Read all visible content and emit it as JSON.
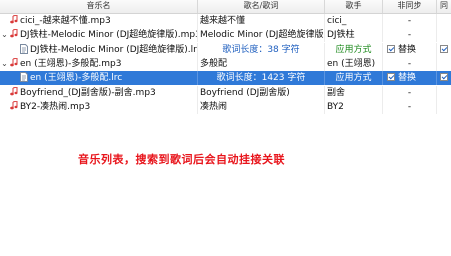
{
  "columns": [
    "音乐名",
    "歌名/歌词",
    "歌手",
    "非同步",
    "同"
  ],
  "rows": [
    {
      "type": "music",
      "expand": "",
      "name": "cici_-越来越不懂.mp3",
      "song": "越来越不懂",
      "singer": "cici_",
      "async": "-",
      "sync": ""
    },
    {
      "type": "music",
      "expand": "⌄",
      "name": "DJ铁柱-Melodic Minor (DJ超绝旋律版).mp3",
      "song": "Melodic Minor (DJ超绝旋律版)",
      "singer": "DJ铁柱",
      "async": "-",
      "sync": ""
    },
    {
      "type": "lrc",
      "name": "DJ铁柱-Melodic Minor (DJ超绝旋律版).lrc",
      "info": "歌词长度：38 字符",
      "mode": "应用方式",
      "async_label": "替换",
      "async_checked": true,
      "sync_checked": true
    },
    {
      "type": "music",
      "expand": "⌄",
      "name": "en (王翊恩)-多般配.mp3",
      "song": "多般配",
      "singer": "en (王翊恩)",
      "async": "-",
      "sync": ""
    },
    {
      "type": "lrc",
      "selected": true,
      "name": "en (王翊恩)-多般配.lrc",
      "info": "歌词长度：1423 字符",
      "mode": "应用方式",
      "async_label": "替换",
      "async_checked": true,
      "sync_checked": true
    },
    {
      "type": "music",
      "expand": "",
      "name": "Boyfriend_(DJ副舍版)-副舍.mp3",
      "song": "Boyfriend (DJ副舍版)",
      "singer": "副舍",
      "async": "-",
      "sync": ""
    },
    {
      "type": "music",
      "expand": "",
      "name": "BY2-凑热闹.mp3",
      "song": "凑热闹",
      "singer": "BY2",
      "async": "-",
      "sync": ""
    }
  ],
  "caption": "音乐列表，搜索到歌词后会自动挂接关联",
  "colors": {
    "selected_row": "#2f79d8",
    "caption": "#e8141b",
    "music_icon": "#d93a3a",
    "info_text": "#1f5fbf",
    "mode_text": "#1e8a1e"
  },
  "icons": {
    "music_file": "music-note-icon",
    "lyric_file": "lyric-file-icon",
    "expand": "chevron-down-icon"
  }
}
